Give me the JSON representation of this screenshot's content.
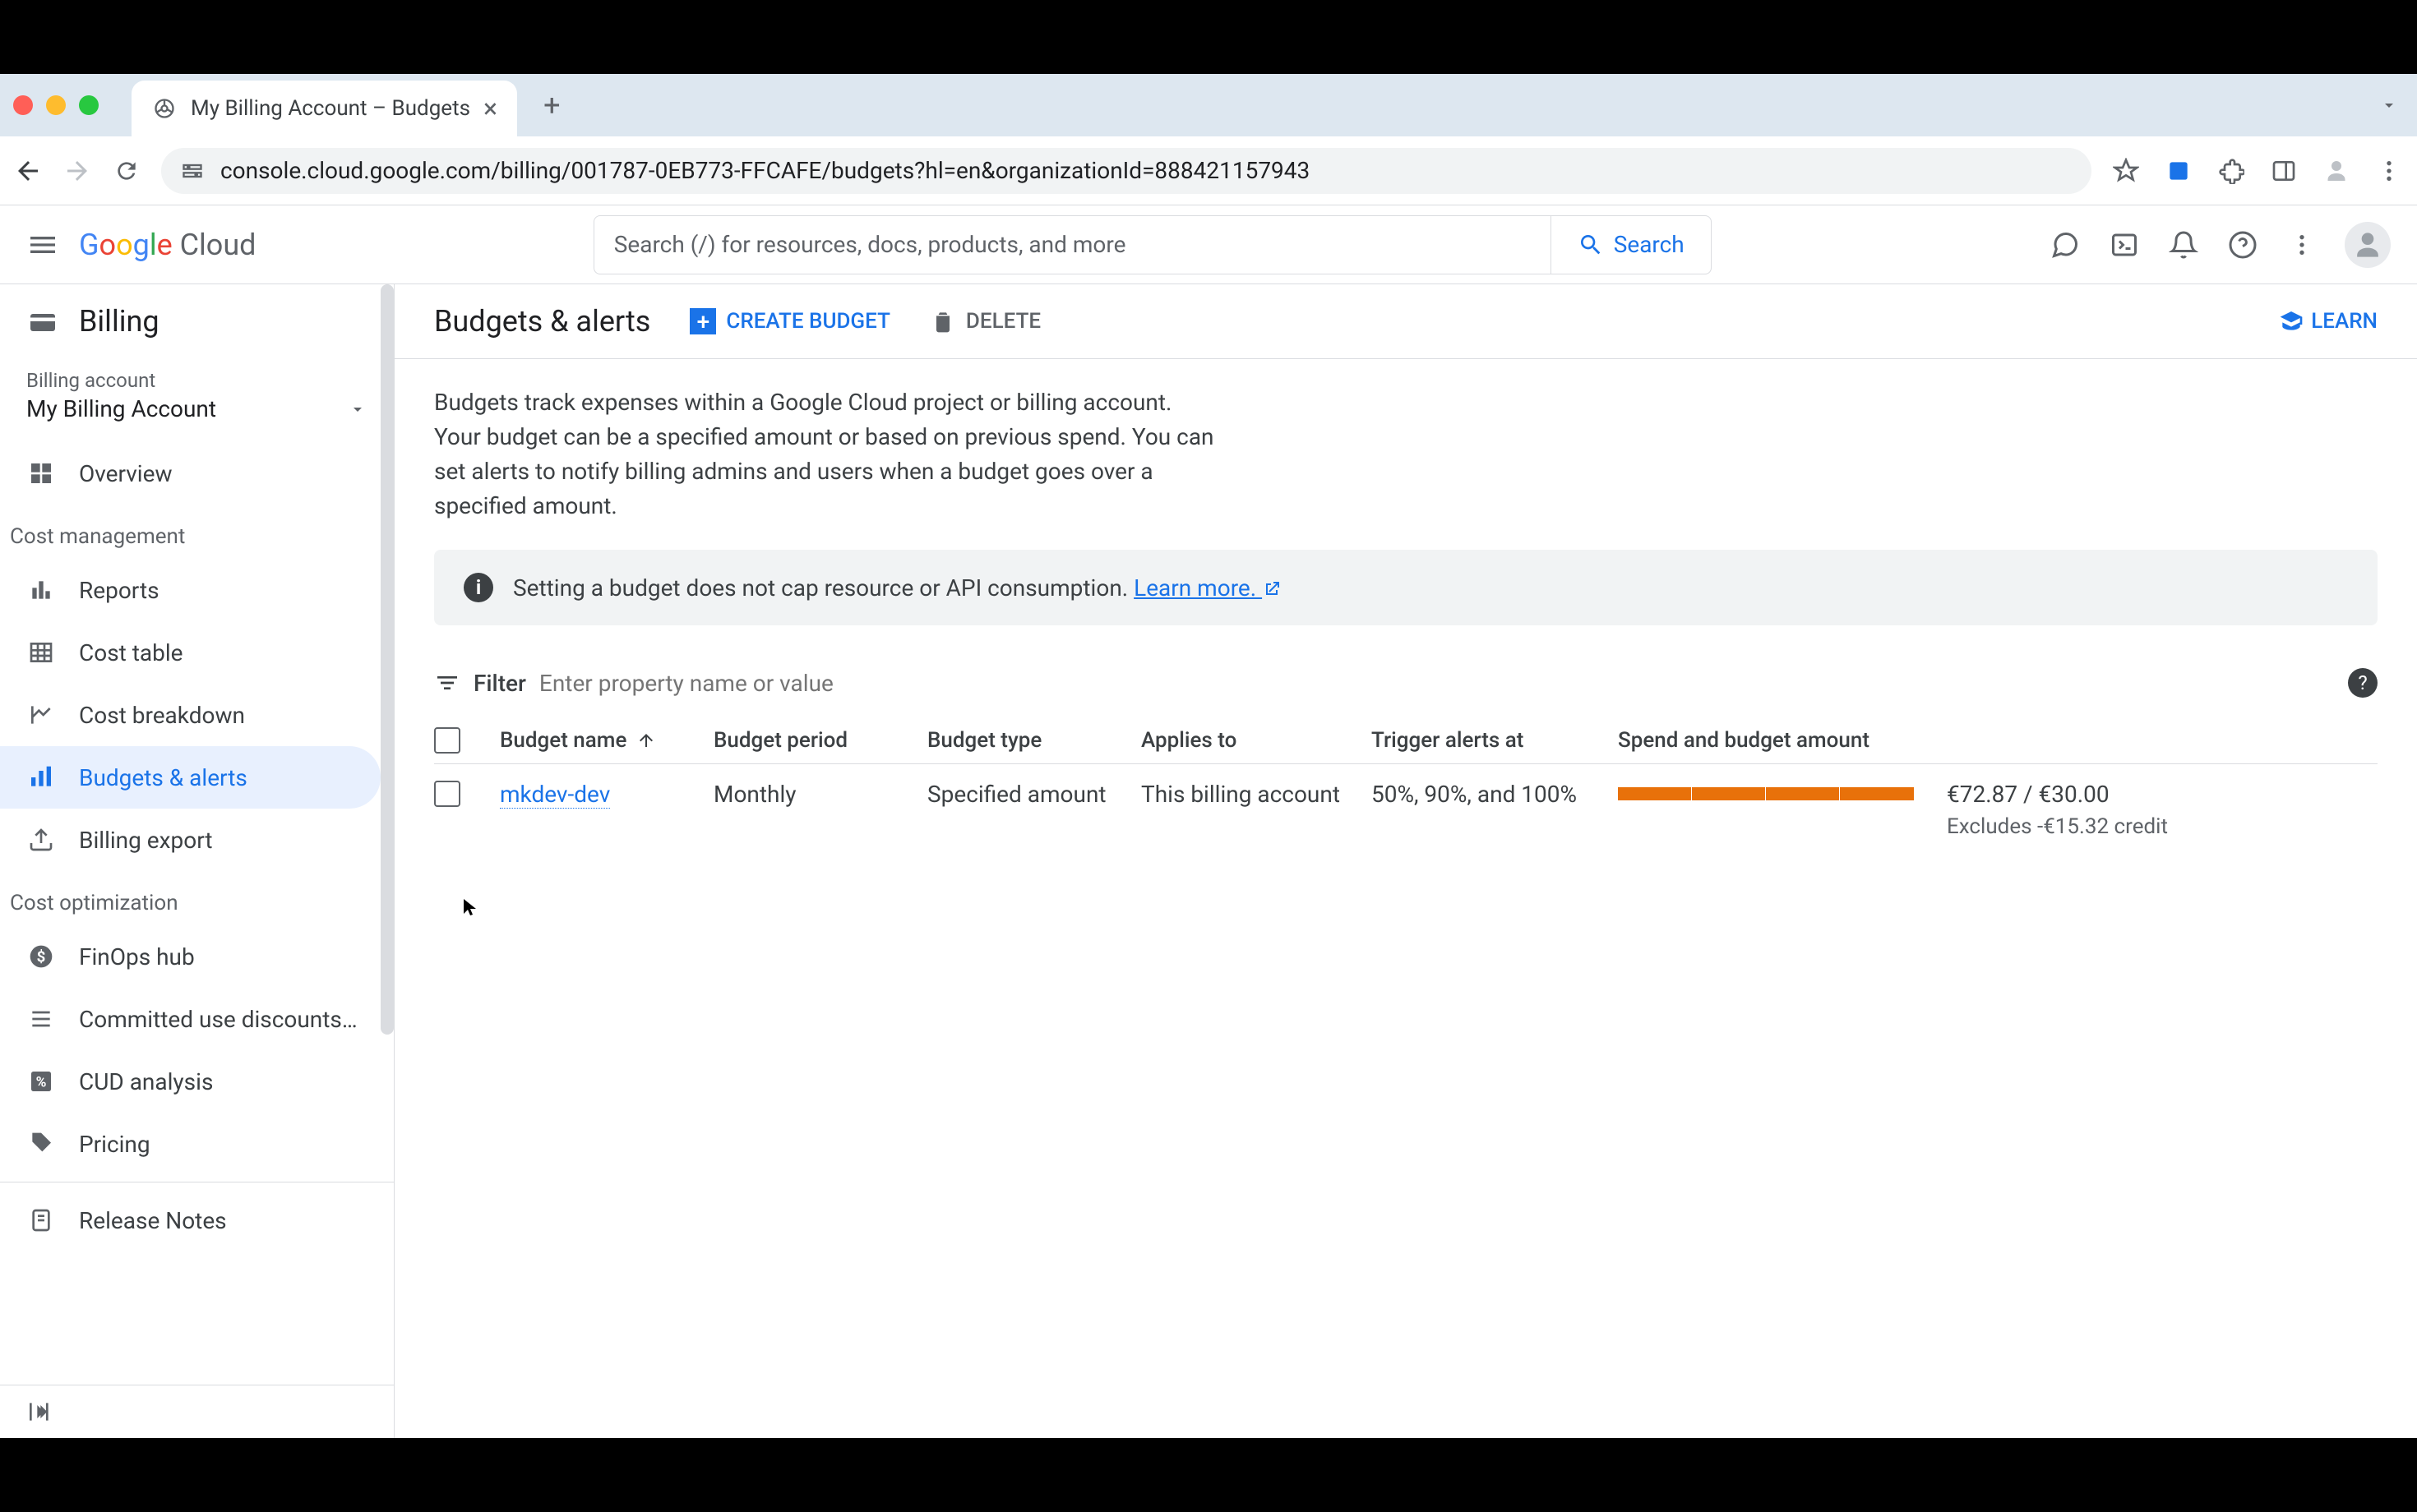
{
  "browser": {
    "tab_title": "My Billing Account – Budgets",
    "url": "console.cloud.google.com/billing/001787-0EB773-FFCAFE/budgets?hl=en&organizationId=888421157943"
  },
  "header": {
    "logo": "Google Cloud",
    "search_placeholder": "Search (/) for resources, docs, products, and more",
    "search_button": "Search"
  },
  "sidebar": {
    "title": "Billing",
    "account_label": "Billing account",
    "account_value": "My Billing Account",
    "item_overview": "Overview",
    "section_cost_management": "Cost management",
    "item_reports": "Reports",
    "item_cost_table": "Cost table",
    "item_cost_breakdown": "Cost breakdown",
    "item_budgets": "Budgets & alerts",
    "item_billing_export": "Billing export",
    "section_cost_optimization": "Cost optimization",
    "item_finops": "FinOps hub",
    "item_cud": "Committed use discounts…",
    "item_cud_analysis": "CUD analysis",
    "item_pricing": "Pricing",
    "item_release_notes": "Release Notes"
  },
  "page": {
    "title": "Budgets & alerts",
    "create_button": "CREATE BUDGET",
    "delete_button": "DELETE",
    "learn_button": "LEARN",
    "description": "Budgets track expenses within a Google Cloud project or billing account. Your budget can be a specified amount or based on previous spend. You can set alerts to notify billing admins and users when a budget goes over a specified amount.",
    "banner_text": "Setting a budget does not cap resource or API consumption. ",
    "banner_link": "Learn more. ",
    "filter_label": "Filter",
    "filter_placeholder": "Enter property name or value"
  },
  "table": {
    "headers": {
      "name": "Budget name",
      "period": "Budget period",
      "type": "Budget type",
      "applies": "Applies to",
      "trigger": "Trigger alerts at",
      "spend": "Spend and budget amount"
    },
    "rows": [
      {
        "name": "mkdev-dev",
        "period": "Monthly",
        "type": "Specified amount",
        "applies": "This billing account",
        "trigger": "50%, 90%, and 100%",
        "spend_amount": "€72.87 / €30.00",
        "spend_sub": "Excludes -€15.32 credit"
      }
    ]
  }
}
